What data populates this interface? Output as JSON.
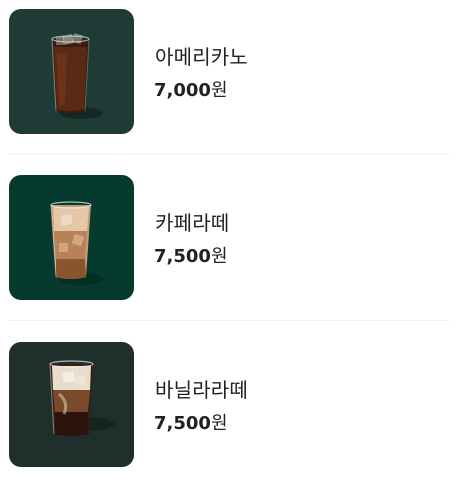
{
  "menu": {
    "items": [
      {
        "name": "아메리카노",
        "price": "7,000",
        "currency": "원",
        "thumb_bg": "#1f3b35",
        "drink": "americano"
      },
      {
        "name": "카페라떼",
        "price": "7,500",
        "currency": "원",
        "thumb_bg": "#073a2e",
        "drink": "caffe-latte"
      },
      {
        "name": "바닐라라떼",
        "price": "7,500",
        "currency": "원",
        "thumb_bg": "#1f302c",
        "drink": "vanilla-latte"
      }
    ]
  }
}
